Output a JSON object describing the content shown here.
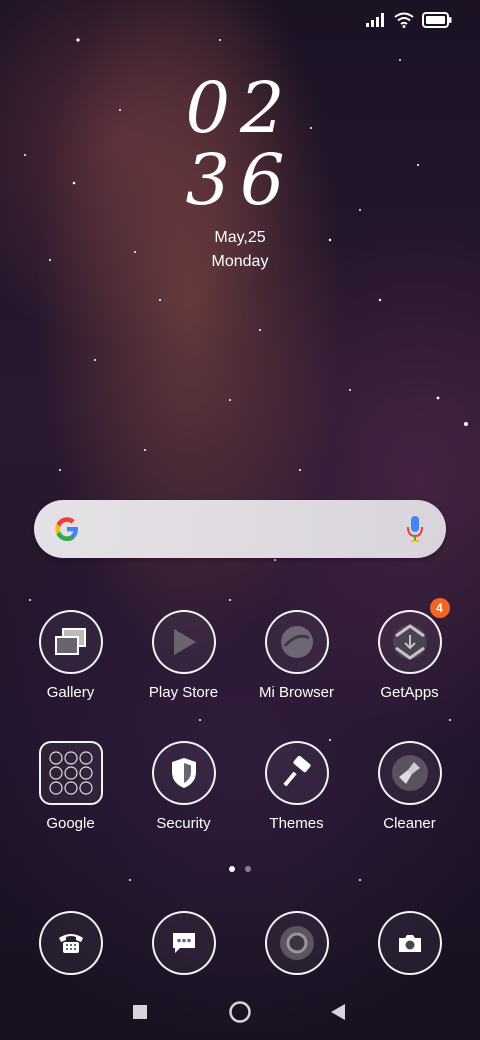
{
  "clock": {
    "hours": "02",
    "minutes": "36"
  },
  "date": {
    "day": "May,25",
    "weekday": "Monday"
  },
  "status_bar": {
    "signal_icon": "signal-bars-icon",
    "wifi_icon": "wifi-icon",
    "battery_icon": "battery-full-icon"
  },
  "search_bar": {
    "logo_icon": "google-g-icon",
    "mic_icon": "microphone-icon"
  },
  "apps_row1": [
    {
      "label": "Gallery",
      "icon": "gallery-icon"
    },
    {
      "label": "Play Store",
      "icon": "play-store-icon"
    },
    {
      "label": "Mi Browser",
      "icon": "mi-browser-icon"
    },
    {
      "label": "GetApps",
      "icon": "getapps-icon",
      "badge": "4"
    }
  ],
  "apps_row2": [
    {
      "label": "Google",
      "icon": "google-folder-icon"
    },
    {
      "label": "Security",
      "icon": "security-shield-icon"
    },
    {
      "label": "Themes",
      "icon": "themes-brush-icon"
    },
    {
      "label": "Cleaner",
      "icon": "cleaner-brush-icon"
    }
  ],
  "page_indicator": {
    "pages": 2,
    "active_page": 1
  },
  "dock": [
    {
      "icon": "phone-icon"
    },
    {
      "icon": "messages-icon"
    },
    {
      "icon": "chrome-icon"
    },
    {
      "icon": "camera-icon"
    }
  ],
  "nav_bar": {
    "recents_icon": "recents-square-icon",
    "home_icon": "home-circle-icon",
    "back_icon": "back-triangle-icon"
  },
  "colors": {
    "badge": "#f26522",
    "search_bg": "#e9e6ea"
  }
}
